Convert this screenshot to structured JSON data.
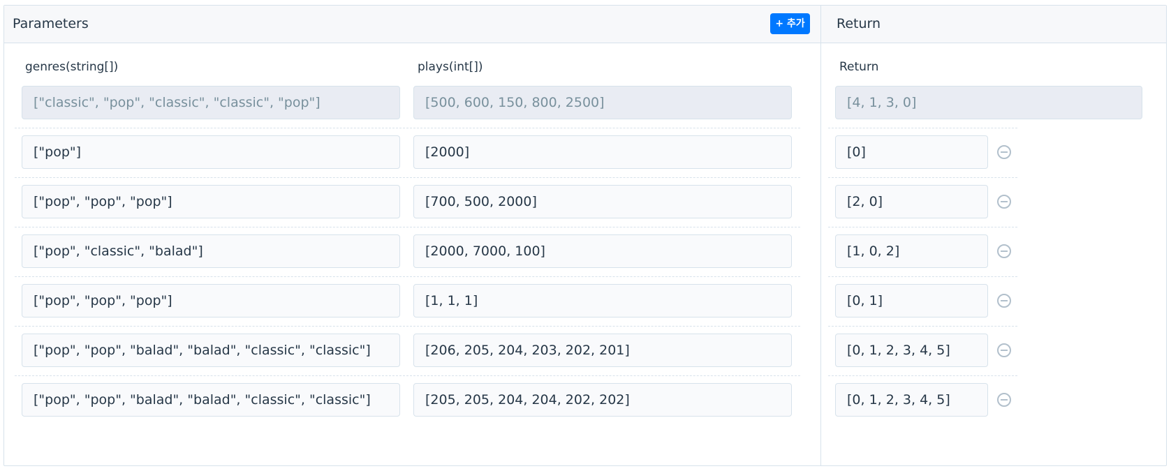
{
  "parameters": {
    "title": "Parameters",
    "add_button_label": "+ 추가",
    "columns": [
      "genres(string[])",
      "plays(int[])"
    ]
  },
  "return_section": {
    "title": "Return",
    "column_label": "Return"
  },
  "example_row": {
    "genres": "[\"classic\", \"pop\", \"classic\", \"classic\", \"pop\"]",
    "plays": "[500, 600, 150, 800, 2500]",
    "return": "[4, 1, 3, 0]"
  },
  "rows": [
    {
      "genres": "[\"pop\"]",
      "plays": "[2000]",
      "return": "[0]"
    },
    {
      "genres": "[\"pop\", \"pop\", \"pop\"]",
      "plays": "[700, 500, 2000]",
      "return": "[2, 0]"
    },
    {
      "genres": "[\"pop\", \"classic\", \"balad\"]",
      "plays": "[2000, 7000, 100]",
      "return": "[1, 0, 2]"
    },
    {
      "genres": "[\"pop\", \"pop\", \"pop\"]",
      "plays": "[1, 1, 1]",
      "return": "[0, 1]"
    },
    {
      "genres": "[\"pop\", \"pop\", \"balad\", \"balad\", \"classic\", \"classic\"]",
      "plays": "[206, 205, 204, 203, 202, 201]",
      "return": "[0, 1, 2, 3, 4, 5]"
    },
    {
      "genres": "[\"pop\", \"pop\", \"balad\", \"balad\", \"classic\", \"classic\"]",
      "plays": "[205, 205, 204, 204, 202, 202]",
      "return": "[0, 1, 2, 3, 4, 5]"
    }
  ],
  "icons": {
    "remove_row": "minus-circle-icon"
  },
  "colors": {
    "accent": "#0078ff",
    "example_field_bg": "#e9ecf3",
    "field_bg": "#f9fafc",
    "border": "#d7e2eb"
  }
}
